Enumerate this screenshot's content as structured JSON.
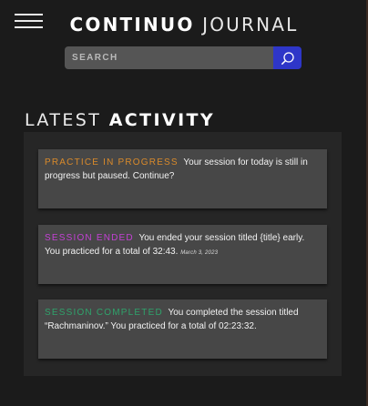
{
  "header": {
    "brand_bold": "CONTINUO",
    "brand_light": "JOURNAL"
  },
  "search": {
    "placeholder": "SEARCH",
    "icon": "search-icon"
  },
  "section": {
    "title_light": "LATEST",
    "title_bold": "ACTIVITY"
  },
  "activity": [
    {
      "tag": "PRACTICE IN PROGRESS",
      "tag_color": "#d98a2b",
      "text": "Your session for today is still in progress but paused. Continue?",
      "date": ""
    },
    {
      "tag": "SESSION ENDED",
      "tag_color": "#c341d4",
      "text": "You ended your session titled {title} early. You practiced for a total of 32:43.",
      "date": "March 3, 2023"
    },
    {
      "tag": "SESSION COMPLETED",
      "tag_color": "#2fa36b",
      "text": "You completed the session titled “Rachmaninov.” You practiced for a total of 02:23:32.",
      "date": ""
    }
  ],
  "colors": {
    "background": "#1b1b1b",
    "panel": "#262626",
    "card": "#474747",
    "search_button": "#2e36c8"
  }
}
